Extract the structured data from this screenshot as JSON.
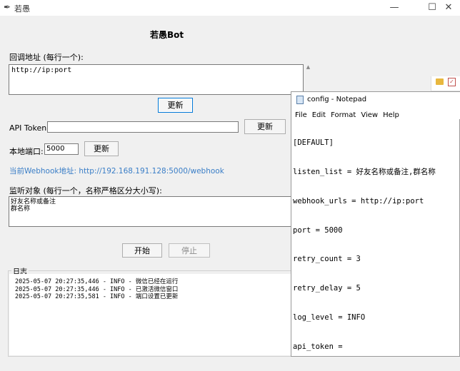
{
  "window": {
    "title": "若愚",
    "minimize": "—",
    "maximize": "☐",
    "close": "✕"
  },
  "app": {
    "heading": "若愚Bot",
    "callback_label": "回调地址 (每行一个):",
    "callback_value": "http://ip:port",
    "update_label": "更新",
    "api_token_label": "API Token:",
    "api_token_value": "",
    "local_port_label": "本地端口:",
    "local_port_value": "5000",
    "webhook_address": "当前Webhook地址: http://192.168.191.128:5000/webhook",
    "listen_label": "监听对象 (每行一个，名称严格区分大小写):",
    "listen_items": [
      "好友名称或备注",
      "群名称"
    ],
    "start_label": "开始",
    "stop_label": "停止",
    "log_title": "日志",
    "log_lines": [
      "2025-05-07 20:27:35,446 - INFO - 微信已经在运行",
      "2025-05-07 20:27:35,446 - INFO - 已激活微信窗口",
      "2025-05-07 20:27:35,581 - INFO - 端口设置已更新"
    ]
  },
  "notepad": {
    "title": "config - Notepad",
    "menu": [
      "File",
      "Edit",
      "Format",
      "View",
      "Help"
    ],
    "lines": [
      "[DEFAULT]",
      "listen_list = 好友名称或备注,群名称",
      "webhook_urls = http://ip:port",
      "port = 5000",
      "retry_count = 3",
      "retry_delay = 5",
      "log_level = INFO",
      "api_token ="
    ]
  },
  "colors": {
    "link": "#3a7ec7",
    "focus_border": "#0078d7"
  },
  "icons": [
    "feather-icon",
    "scroll-up-icon",
    "folder-icon",
    "checklist-icon",
    "notepad-icon"
  ]
}
